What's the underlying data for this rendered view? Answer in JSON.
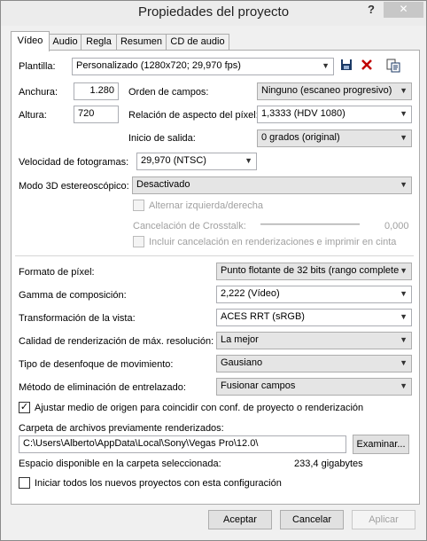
{
  "window": {
    "title": "Propiedades del proyecto",
    "help_icon": "?",
    "close_icon": "✕"
  },
  "tabs": [
    {
      "label": "Vídeo",
      "active": true
    },
    {
      "label": "Audio",
      "active": false
    },
    {
      "label": "Regla",
      "active": false
    },
    {
      "label": "Resumen",
      "active": false
    },
    {
      "label": "CD de audio",
      "active": false
    }
  ],
  "video": {
    "template_label": "Plantilla:",
    "template_value": "Personalizado (1280x720; 29,970 fps)",
    "width_label": "Anchura:",
    "width_value": "1.280",
    "height_label": "Altura:",
    "height_value": "720",
    "field_order_label": "Orden de campos:",
    "field_order_value": "Ninguno (escaneo progresivo)",
    "pixel_aspect_label": "Relación de aspecto del píxel:",
    "pixel_aspect_value": "1,3333 (HDV 1080)",
    "output_rotation_label": "Inicio de salida:",
    "output_rotation_value": "0 grados (original)",
    "frame_rate_label": "Velocidad de fotogramas:",
    "frame_rate_value": "29,970 (NTSC)",
    "stereo3d_label": "Modo 3D estereoscópico:",
    "stereo3d_value": "Desactivado",
    "swap_lr_label": "Alternar izquierda/derecha",
    "crosstalk_label": "Cancelación de Crosstalk:",
    "crosstalk_value": "0,000",
    "include_cancel_label": "Incluir cancelación en renderizaciones e imprimir en cinta",
    "pixel_format_label": "Formato de píxel:",
    "pixel_format_value": "Punto flotante de 32 bits (rango complete",
    "compositing_gamma_label": "Gamma de composición:",
    "compositing_gamma_value": "2,222 (Vídeo)",
    "view_transform_label": "Transformación de la vista:",
    "view_transform_value": "ACES RRT (sRGB)",
    "render_quality_label": "Calidad de renderización de máx. resolución:",
    "render_quality_value": "La mejor",
    "motion_blur_label": "Tipo de desenfoque de movimiento:",
    "motion_blur_value": "Gausiano",
    "deinterlace_label": "Método de eliminación de entrelazado:",
    "deinterlace_value": "Fusionar campos",
    "adjust_source_label": "Ajustar medio de origen para coincidir con conf. de proyecto o renderización",
    "adjust_source_checked": true,
    "prerender_folder_label": "Carpeta de archivos previamente renderizados:",
    "prerender_folder_value": "C:\\Users\\Alberto\\AppData\\Local\\Sony\\Vegas Pro\\12.0\\",
    "browse_label": "Examinar...",
    "free_space_label": "Espacio disponible en la carpeta seleccionada:",
    "free_space_value": "233,4 gigabytes",
    "start_all_label": "Iniciar todos los nuevos proyectos con esta configuración",
    "start_all_checked": false
  },
  "footer": {
    "ok_label": "Aceptar",
    "cancel_label": "Cancelar",
    "apply_label": "Aplicar"
  },
  "icons": {
    "save": "save-icon",
    "delete": "delete-icon",
    "copy": "copy-icon"
  }
}
